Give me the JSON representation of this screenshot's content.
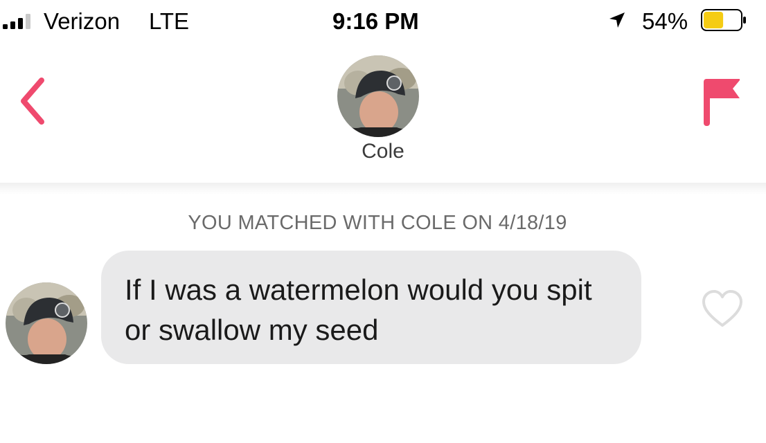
{
  "status_bar": {
    "carrier": "Verizon",
    "network": "LTE",
    "time": "9:16 PM",
    "battery_percent": "54%",
    "battery_level": 0.54,
    "icons": [
      "signal-bars-icon",
      "location-arrow-icon",
      "battery-icon"
    ]
  },
  "header": {
    "name": "Cole",
    "icons": [
      "back-chevron-icon",
      "report-flag-icon"
    ]
  },
  "conversation": {
    "match_notice": "YOU MATCHED WITH COLE ON 4/18/19",
    "messages": [
      {
        "text": "If I was a watermelon would you spit or swallow my seed",
        "icon": "heart-outline-icon"
      }
    ]
  },
  "colors": {
    "accent": "#ef4a6e",
    "bubble": "#e9e9ea",
    "battery_fill": "#f5cc14"
  }
}
